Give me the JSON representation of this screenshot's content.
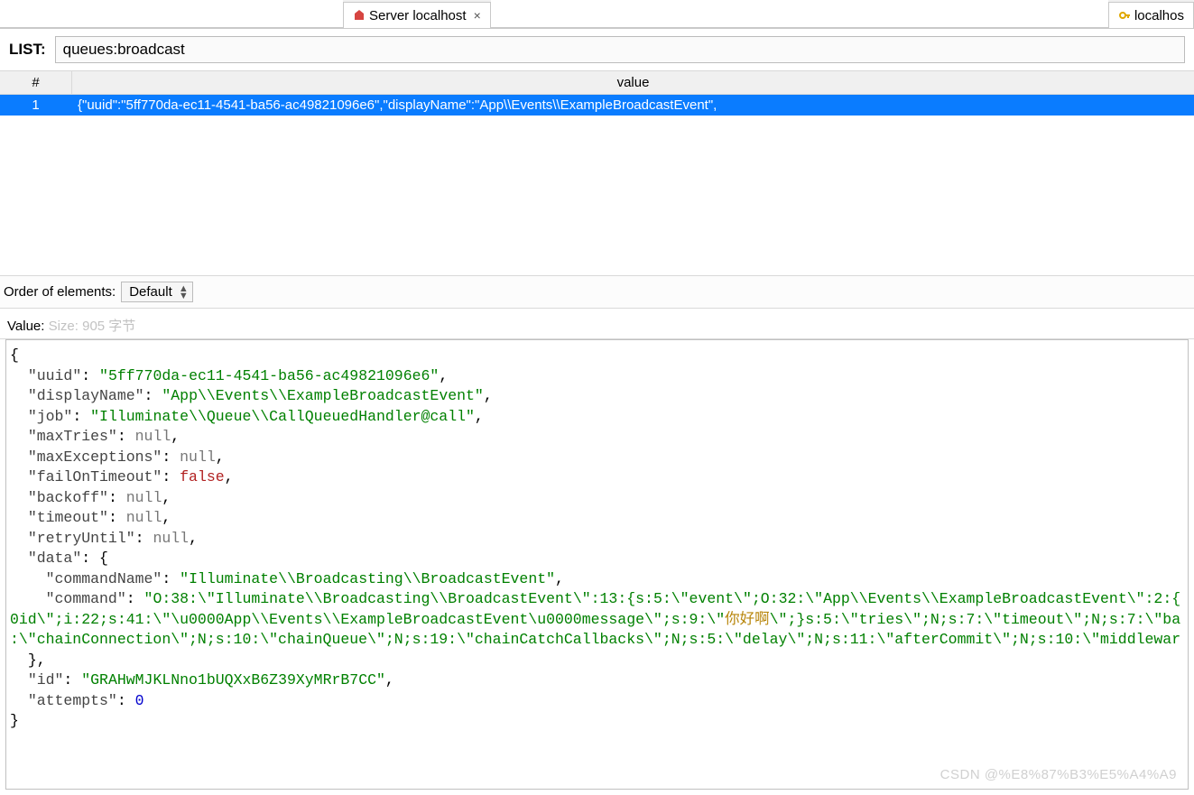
{
  "tabs": {
    "active": {
      "label": "Server localhost"
    },
    "right": {
      "label": "localhos"
    }
  },
  "key": {
    "type_label": "LIST:",
    "name": "queues:broadcast"
  },
  "table": {
    "headers": {
      "index": "#",
      "value": "value"
    },
    "rows": [
      {
        "index": "1",
        "value": "{\"uuid\":\"5ff770da-ec11-4541-ba56-ac49821096e6\",\"displayName\":\"App\\\\Events\\\\ExampleBroadcastEvent\","
      }
    ]
  },
  "order": {
    "label": "Order of elements:",
    "selected": "Default"
  },
  "value_panel": {
    "label": "Value:",
    "size_text": "Size: 905 字节"
  },
  "json": {
    "uuid": "5ff770da-ec11-4541-ba56-ac49821096e6",
    "displayName": "App\\\\Events\\\\ExampleBroadcastEvent",
    "job": "Illuminate\\\\Queue\\\\CallQueuedHandler@call",
    "maxTries": null,
    "maxExceptions": null,
    "failOnTimeout": false,
    "backoff": null,
    "timeout": null,
    "retryUntil": null,
    "data": {
      "commandName": "Illuminate\\\\Broadcasting\\\\BroadcastEvent",
      "command_line1": "O:38:\\\"Illuminate\\\\Broadcasting\\\\BroadcastEvent\\\":13:{s:5:\\\"event\\\";O:32:\\\"App\\\\Events\\\\ExampleBroadcastEvent\\\":2:{",
      "command_line2_pre": "0id\\\";i:22;s:41:\\\"\\u0000App\\\\Events\\\\ExampleBroadcastEvent\\u0000message\\\";s:9:\\\"",
      "command_line2_cjk": "你好啊",
      "command_line2_post": "\\\";}s:5:\\\"tries\\\";N;s:7:\\\"timeout\\\";N;s:7:\\\"ba",
      "command_line3": ":\\\"chainConnection\\\";N;s:10:\\\"chainQueue\\\";N;s:19:\\\"chainCatchCallbacks\\\";N;s:5:\\\"delay\\\";N;s:11:\\\"afterCommit\\\";N;s:10:\\\"middlewar"
    },
    "id": "GRAHwMJKLNno1bUQXxB6Z39XyMRrB7CC",
    "attempts": 0
  },
  "watermark": "CSDN @%E8%87%B3%E5%A4%A9"
}
